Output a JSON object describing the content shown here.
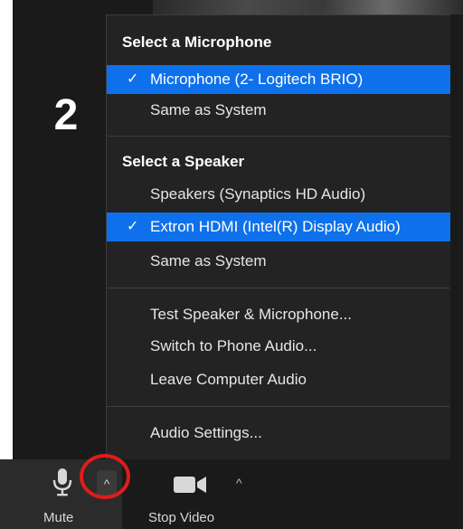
{
  "annotation": {
    "step_number": "2"
  },
  "audio_menu": {
    "microphone_header": "Select a Microphone",
    "microphone_items": [
      {
        "label": "Microphone (2- Logitech BRIO)",
        "selected": true
      },
      {
        "label": "Same as System",
        "selected": false
      }
    ],
    "speaker_header": "Select a Speaker",
    "speaker_items": [
      {
        "label": "Speakers (Synaptics HD Audio)",
        "selected": false
      },
      {
        "label": "Extron HDMI (Intel(R) Display Audio)",
        "selected": true
      },
      {
        "label": "Same as System",
        "selected": false
      }
    ],
    "actions": [
      "Test Speaker & Microphone...",
      "Switch to Phone Audio...",
      "Leave Computer Audio"
    ],
    "settings_label": "Audio Settings...",
    "check_glyph": "✓"
  },
  "toolbar": {
    "mute_label": "Mute",
    "stop_video_label": "Stop Video",
    "icons": {
      "mute": "microphone-icon",
      "audio_options": "chevron-up-icon",
      "video": "video-camera-icon",
      "video_options": "chevron-up-icon"
    },
    "caret_glyph": "^"
  },
  "colors": {
    "selection": "#0e71eb",
    "menu_background": "#232323",
    "highlight_ring": "#e01c1c"
  }
}
